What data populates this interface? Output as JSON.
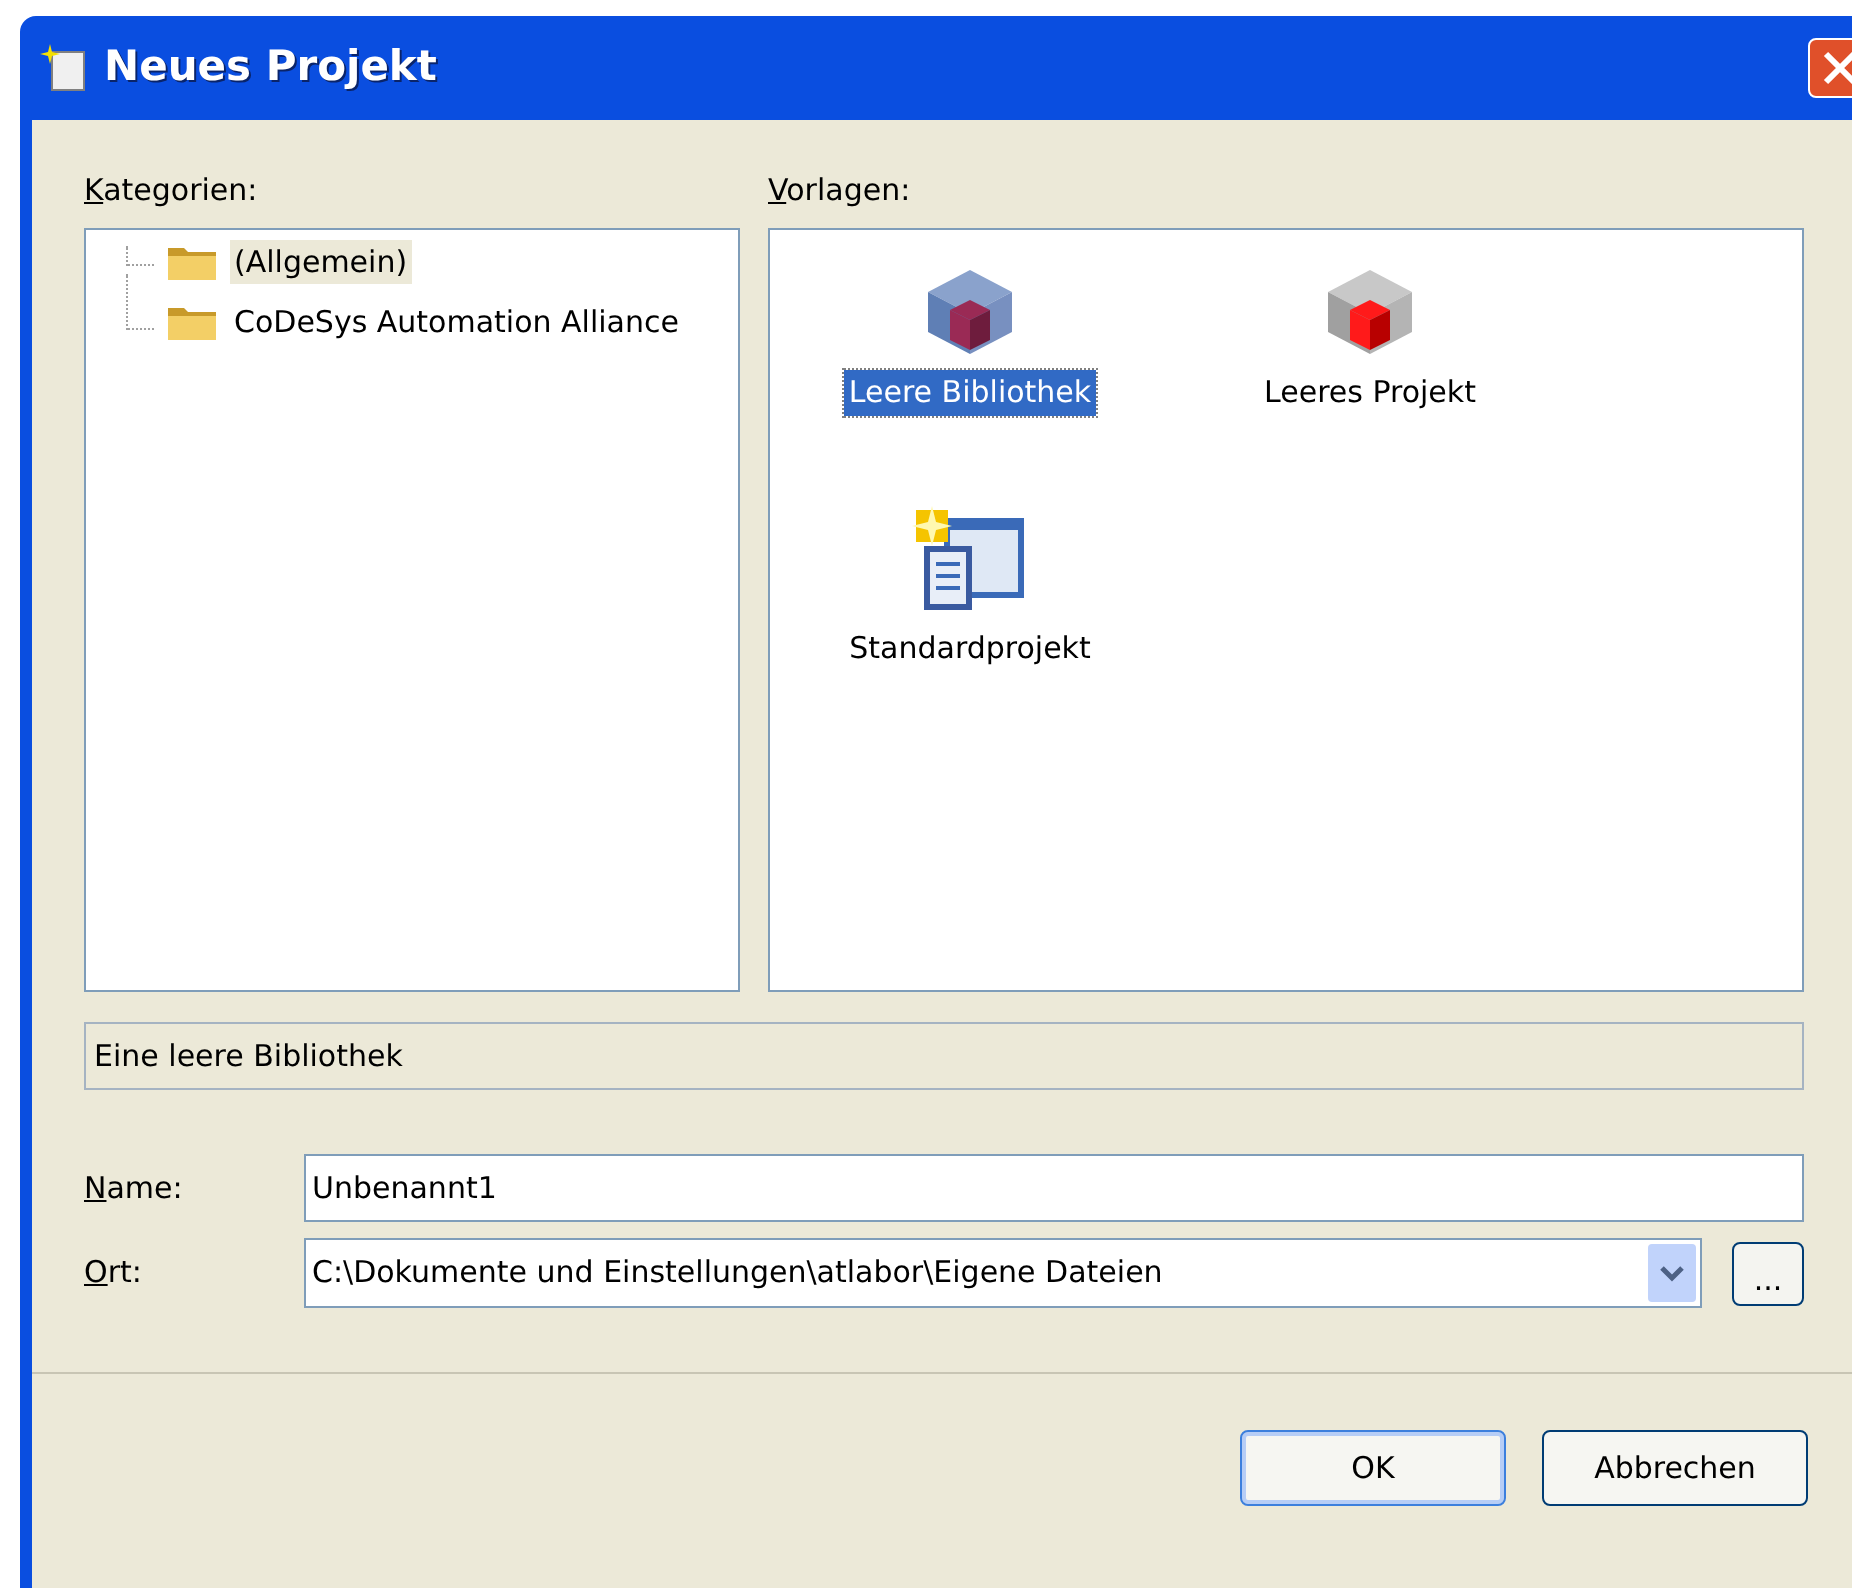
{
  "window": {
    "title": "Neues Projekt"
  },
  "categories": {
    "label": "Kategorien:",
    "items": [
      {
        "label": "(Allgemein)",
        "selected": true
      },
      {
        "label": "CoDeSys Automation Alliance",
        "selected": false
      }
    ]
  },
  "templates": {
    "label": "Vorlagen:",
    "items": [
      {
        "label": "Leere Bibliothek",
        "kind": "library",
        "selected": true
      },
      {
        "label": "Leeres Projekt",
        "kind": "project",
        "selected": false
      },
      {
        "label": "Standardprojekt",
        "kind": "standard",
        "selected": false
      }
    ]
  },
  "description": "Eine leere Bibliothek",
  "name": {
    "label": "Name:",
    "value": "Unbenannt1"
  },
  "location": {
    "label": "Ort:",
    "value": "C:\\Dokumente und Einstellungen\\atlabor\\Eigene Dateien",
    "browse": "..."
  },
  "buttons": [
    {
      "label": "OK",
      "default": true
    },
    {
      "label": "Abbrechen",
      "default": false
    }
  ]
}
